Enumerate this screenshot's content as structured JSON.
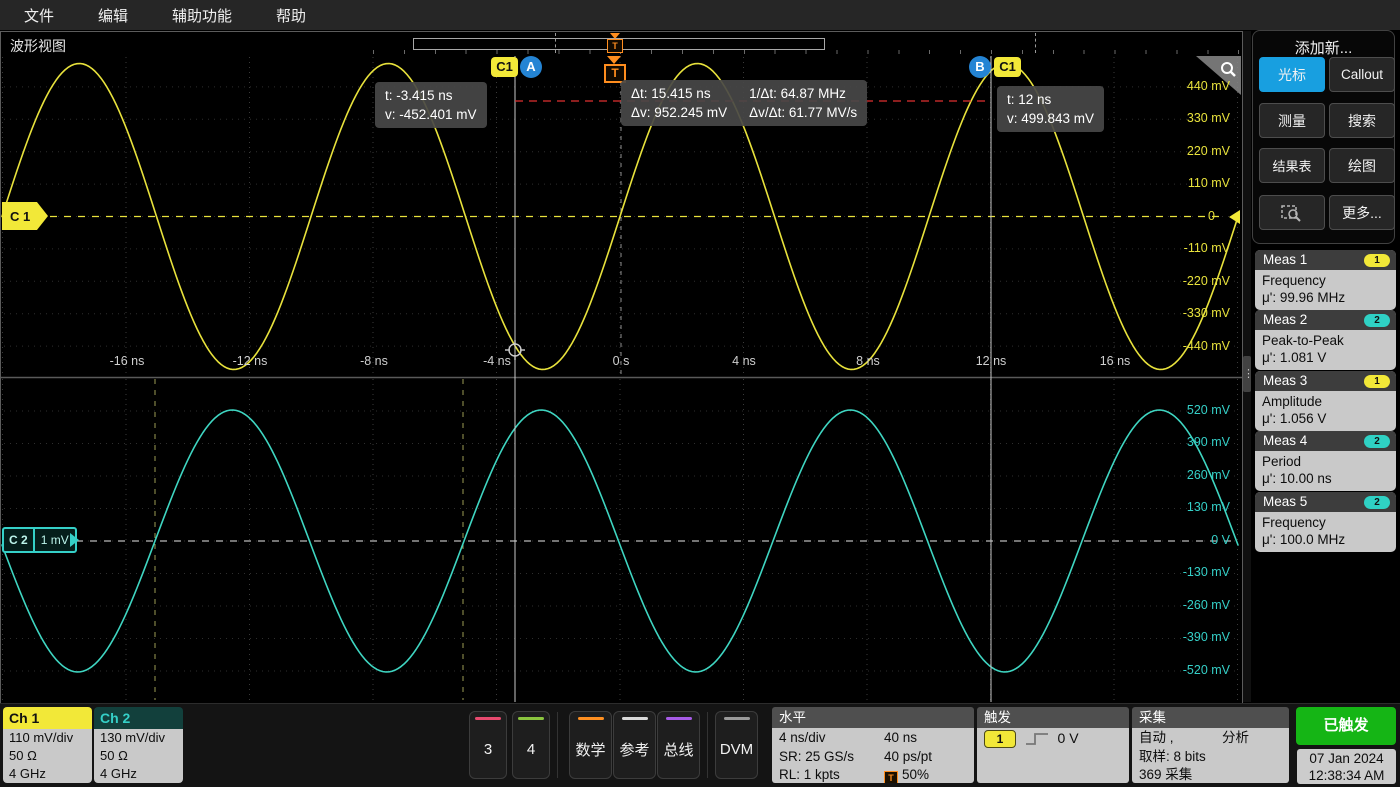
{
  "menu": {
    "items": [
      "文件",
      "编辑",
      "辅助功能",
      "帮助"
    ]
  },
  "view_tab": "波形视图",
  "overlay": {
    "cursor_a": {
      "channel_badge": "C1",
      "badge": "A",
      "line1": "t: -3.415 ns",
      "line2": "v: -452.401 mV"
    },
    "cursor_b": {
      "badge": "B",
      "channel_badge": "C1",
      "line1": "t: 12 ns",
      "line2": "v: 499.843 mV"
    },
    "delta": {
      "dt": "Δt: 15.415 ns",
      "inv_dt": "1/Δt: 64.87 MHz",
      "dv": "Δv: 952.245 mV",
      "dvdt": "Δv/Δt: 61.77 MV/s"
    },
    "trigger_label": "T"
  },
  "axes": {
    "time": [
      "-16 ns",
      "-12 ns",
      "-8 ns",
      "-4 ns",
      "0 s",
      "4 ns",
      "8 ns",
      "12 ns",
      "16 ns"
    ],
    "ch1": [
      "440 mV",
      "330 mV",
      "220 mV",
      "110 mV",
      "0",
      "-110 mV",
      "-220 mV",
      "-330 mV",
      "-440 mV"
    ],
    "ch2": [
      "520 mV",
      "390 mV",
      "260 mV",
      "130 mV",
      "0 V",
      "-130 mV",
      "-260 mV",
      "-390 mV",
      "-520 mV"
    ]
  },
  "graticule_badges": {
    "c1": "C 1",
    "c2": "C 2",
    "c2_offset": "1 mV"
  },
  "sidebar": {
    "title": "添加新...",
    "buttons": [
      {
        "label": "光标",
        "active": true
      },
      {
        "label": "Callout",
        "active": false
      },
      {
        "label": "测量",
        "active": false
      },
      {
        "label": "搜索",
        "active": false
      },
      {
        "label": "结果表",
        "active": false
      },
      {
        "label": "绘图",
        "active": false
      },
      {
        "label": "",
        "icon": "zoom-box",
        "active": false
      },
      {
        "label": "更多...",
        "active": false
      }
    ]
  },
  "measurements": [
    {
      "title": "Meas 1",
      "source": "1",
      "source_color": "#f2e838",
      "name": "Frequency",
      "value": "μ': 99.96 MHz"
    },
    {
      "title": "Meas 2",
      "source": "2",
      "source_color": "#2fd1c4",
      "name": "Peak-to-Peak",
      "value": "μ': 1.081 V"
    },
    {
      "title": "Meas 3",
      "source": "1",
      "source_color": "#f2e838",
      "name": "Amplitude",
      "value": "μ': 1.056 V"
    },
    {
      "title": "Meas 4",
      "source": "2",
      "source_color": "#2fd1c4",
      "name": "Period",
      "value": "μ': 10.00 ns"
    },
    {
      "title": "Meas 5",
      "source": "2",
      "source_color": "#2fd1c4",
      "name": "Frequency",
      "value": "μ': 100.0 MHz"
    }
  ],
  "bottom": {
    "ch1": {
      "label": "Ch 1",
      "scale": "110 mV/div",
      "impedance": "50 Ω",
      "bandwidth": "4 GHz",
      "color": "#f2e838"
    },
    "ch2": {
      "label": "Ch 2",
      "scale": "130 mV/div",
      "impedance": "50 Ω",
      "bandwidth": "4 GHz",
      "color": "#35d0c8"
    },
    "channel_buttons": [
      {
        "label": "3",
        "stripe": "#e84a6f"
      },
      {
        "label": "4",
        "stripe": "#8bc53f"
      },
      {
        "label": "数学",
        "stripe": "#ff9021"
      },
      {
        "label": "参考",
        "stripe": "#d9d9d9"
      },
      {
        "label": "总线",
        "stripe": "#a85ce8"
      },
      {
        "label": "DVM",
        "stripe": "#9a9a9a"
      }
    ],
    "horizontal": {
      "title": "水平",
      "scale": "4 ns/div",
      "window": "40 ns",
      "sr": "SR: 25 GS/s",
      "res": "40 ps/pt",
      "rl": "RL: 1 kpts",
      "pos": "50%"
    },
    "trigger": {
      "title": "触发",
      "source": "1",
      "level": "0 V"
    },
    "acquisition": {
      "title": "采集",
      "mode": "自动 ,",
      "analyze": "分析",
      "sample": "取样: 8 bits",
      "count": "369 采集"
    },
    "status": {
      "triggered": "已触发",
      "date": "07 Jan 2024",
      "time": "12:38:34 AM"
    }
  },
  "chart_data": {
    "type": "line",
    "title": "Oscilloscope waveform view (two graticules)",
    "x_axis": {
      "ticks": [
        "-16 ns",
        "-12 ns",
        "-8 ns",
        "-4 ns",
        "0 s",
        "4 ns",
        "8 ns",
        "12 ns",
        "16 ns"
      ],
      "scale": "4 ns/div",
      "window": "40 ns"
    },
    "series": [
      {
        "name": "Ch 1",
        "color": "#e8e23c",
        "shape": "sine",
        "frequency_MHz": 99.96,
        "period_ns": 10,
        "peak_to_peak_V": 1.081,
        "offset_mV": 0,
        "vertical_scale": "110 mV/div",
        "phase": "rising zero-crossing at t=0 (trigger)"
      },
      {
        "name": "Ch 2",
        "color": "#3fd6c2",
        "shape": "sine",
        "frequency_MHz": 100.0,
        "period_ns": 10,
        "peak_to_peak_V": 1.04,
        "offset_mV": 0,
        "vertical_scale": "130 mV/div",
        "phase": "inverted (180°) relative to Ch 1"
      }
    ],
    "cursors": {
      "a_t_ns": -3.415,
      "a_v_mV": -452.401,
      "b_t_ns": 12,
      "b_v_mV": 499.843,
      "dt_ns": 15.415,
      "inv_dt_MHz": 64.87,
      "dv_mV": 952.245,
      "dvdt": "61.77 MV/s"
    }
  }
}
